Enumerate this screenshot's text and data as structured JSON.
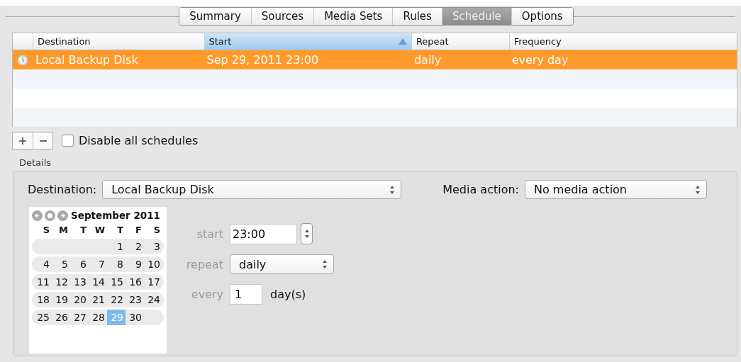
{
  "tabs": [
    {
      "label": "Summary",
      "selected": false
    },
    {
      "label": "Sources",
      "selected": false
    },
    {
      "label": "Media Sets",
      "selected": false
    },
    {
      "label": "Rules",
      "selected": false
    },
    {
      "label": "Schedule",
      "selected": true
    },
    {
      "label": "Options",
      "selected": false
    }
  ],
  "table": {
    "columns": [
      {
        "label": "Destination",
        "sorted": false
      },
      {
        "label": "Start",
        "sorted": true
      },
      {
        "label": "Repeat",
        "sorted": false
      },
      {
        "label": "Frequency",
        "sorted": false
      }
    ],
    "rows": [
      {
        "selected": true,
        "cells": [
          "Local Backup Disk",
          "Sep 29, 2011 23:00",
          "daily",
          "every day"
        ]
      }
    ]
  },
  "disable_all": {
    "label": "Disable all schedules",
    "checked": false
  },
  "details": {
    "title": "Details",
    "destination": {
      "label": "Destination:",
      "value": "Local Backup Disk"
    },
    "media_action": {
      "label": "Media action:",
      "value": "No media action"
    },
    "calendar": {
      "month": "September 2011",
      "weekdays": [
        "S",
        "M",
        "T",
        "W",
        "T",
        "F",
        "S"
      ],
      "weeks": [
        [
          {
            "day": "1",
            "selected": false
          },
          {
            "day": "2",
            "selected": false
          },
          {
            "day": "3",
            "selected": false
          }
        ],
        [
          {
            "day": "4",
            "selected": false
          },
          {
            "day": "5",
            "selected": false
          },
          {
            "day": "6",
            "selected": false
          },
          {
            "day": "7",
            "selected": false
          },
          {
            "day": "8",
            "selected": false
          },
          {
            "day": "9",
            "selected": false
          },
          {
            "day": "10",
            "selected": false
          }
        ],
        [
          {
            "day": "11",
            "selected": false
          },
          {
            "day": "12",
            "selected": false
          },
          {
            "day": "13",
            "selected": false
          },
          {
            "day": "14",
            "selected": false
          },
          {
            "day": "15",
            "selected": false
          },
          {
            "day": "16",
            "selected": false
          },
          {
            "day": "17",
            "selected": false
          }
        ],
        [
          {
            "day": "18",
            "selected": false
          },
          {
            "day": "19",
            "selected": false
          },
          {
            "day": "20",
            "selected": false
          },
          {
            "day": "21",
            "selected": false
          },
          {
            "day": "22",
            "selected": false
          },
          {
            "day": "23",
            "selected": false
          },
          {
            "day": "24",
            "selected": false
          }
        ],
        [
          {
            "day": "25",
            "selected": false
          },
          {
            "day": "26",
            "selected": false
          },
          {
            "day": "27",
            "selected": false
          },
          {
            "day": "28",
            "selected": false
          },
          {
            "day": "29",
            "selected": true
          },
          {
            "day": "30",
            "selected": false
          }
        ]
      ]
    },
    "start": {
      "label": "start",
      "value": "23:00"
    },
    "repeat": {
      "label": "repeat",
      "value": "daily"
    },
    "every": {
      "label": "every",
      "value": "1",
      "unit": "day(s)"
    }
  }
}
